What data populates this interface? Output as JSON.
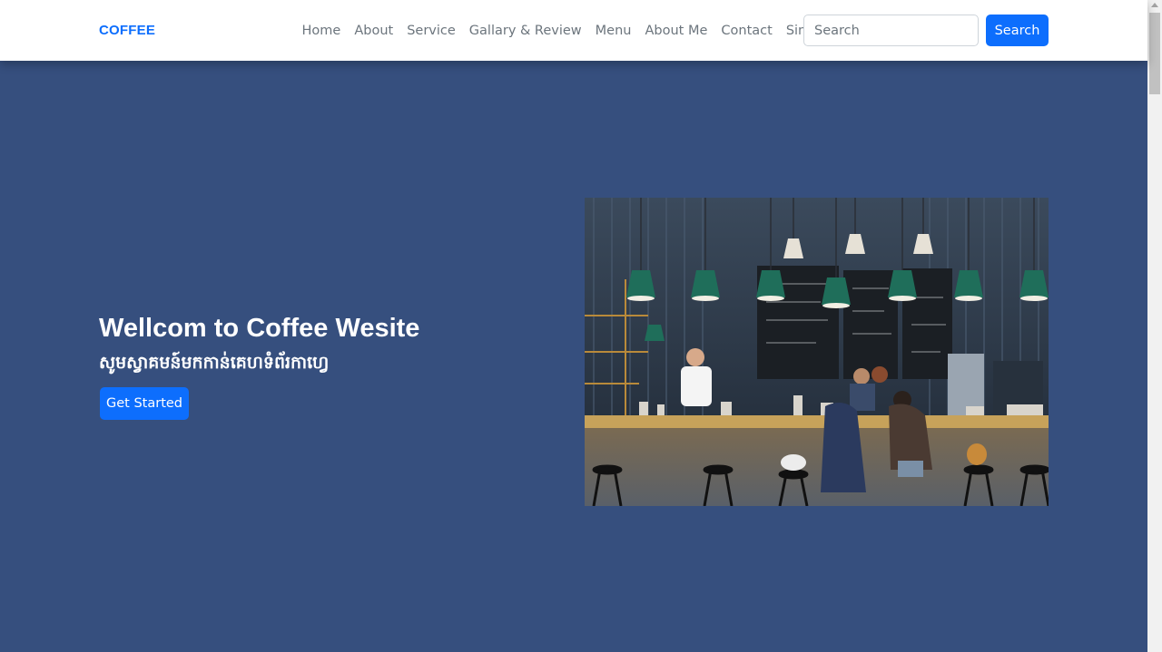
{
  "navbar": {
    "brand": "COFFEE",
    "links": [
      "Home",
      "About",
      "Service",
      "Gallary & Review",
      "Menu",
      "About Me",
      "Contact",
      "Sing In"
    ],
    "search_placeholder": "Search",
    "search_button": "Search"
  },
  "hero": {
    "title": "Wellcom to Coffee Wesite",
    "subtitle": "សូមស្វាគមន៍មកកាន់គេហទំព័រកាហ្វេ",
    "cta_label": "Get Started",
    "image_alt": "Coffee shop interior with green pendant lamps, a barista and customers at the counter"
  },
  "colors": {
    "accent": "#0d6efd",
    "hero_background": "#364f7e",
    "navbar_background": "#ffffff",
    "nav_link": "#6c757d"
  }
}
